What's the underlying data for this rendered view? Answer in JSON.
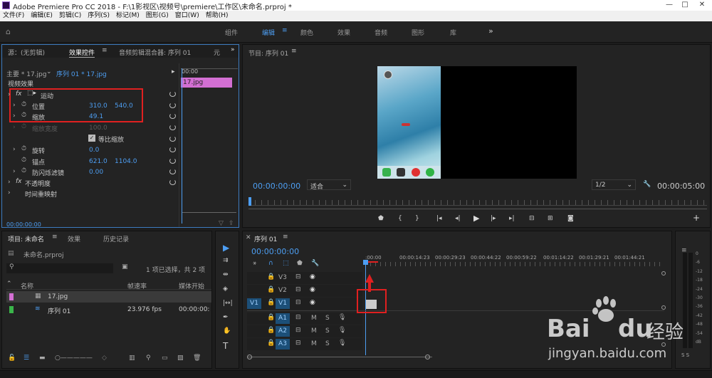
{
  "window": {
    "title": "Adobe Premiere Pro CC 2018 - F:\\1影视区\\视频号\\premiere\\工作区\\未命名.prproj *",
    "controls": [
      "—",
      "□",
      "✕"
    ]
  },
  "menu": [
    "文件(F)",
    "编辑(E)",
    "剪辑(C)",
    "序列(S)",
    "标记(M)",
    "图形(G)",
    "窗口(W)",
    "帮助(H)"
  ],
  "workspaces": [
    "组件",
    "编辑",
    "颜色",
    "效果",
    "音频",
    "图形",
    "库"
  ],
  "workspace_more": "»",
  "effect_controls": {
    "tabs": [
      "源：(无剪辑)",
      "效果控件",
      "音频剪辑混合器: 序列 01",
      "元"
    ],
    "master_label": "主要 * 17.jpg",
    "seq_label": "序列 01 * 17.jpg",
    "timecode_start": "00:00",
    "clip_name": "17.jpg",
    "video_effects": "视频效果",
    "motion": "运动",
    "position": {
      "label": "位置",
      "x": "310.0",
      "y": "540.0"
    },
    "scale": {
      "label": "缩放",
      "value": "49.1"
    },
    "scale_width": {
      "label": "缩放宽度",
      "value": "100.0"
    },
    "uniform_scale": "等比缩放",
    "rotation": {
      "label": "旋转",
      "value": "0.0"
    },
    "anchor": {
      "label": "锚点",
      "x": "621.0",
      "y": "1104.0"
    },
    "anti_flicker": {
      "label": "防闪烁滤镜",
      "value": "0.00"
    },
    "opacity": "不透明度",
    "time_remap": "时间重映射",
    "footer_time": "00:00:00:00"
  },
  "program": {
    "title": "节目: 序列 01",
    "timecode": "00:00:00:00",
    "fit": "适合",
    "resolution": "1/2",
    "duration": "00:00:05:00"
  },
  "project": {
    "tabs": [
      "项目: 未命名",
      "效果",
      "历史记录"
    ],
    "file": "未命名.prproj",
    "selection": "1 项已选择，共 2 项",
    "columns": [
      "名称",
      "帧速率",
      "媒体开始"
    ],
    "items": [
      {
        "name": "17.jpg",
        "fps": "",
        "start": "",
        "color": "#d36fd3"
      },
      {
        "name": "序列 01",
        "fps": "23.976 fps",
        "start": "00:00:00:",
        "color": "#3ab54a"
      }
    ]
  },
  "timeline": {
    "title": "序列 01",
    "timecode": "00:00:00:00",
    "ruler": [
      ":00:00",
      "00:00:14:23",
      "00:00:29:23",
      "00:00:44:22",
      "00:00:59:22",
      "00:01:14:22",
      "00:01:29:21",
      "00:01:44:21"
    ],
    "video_tracks": [
      "V3",
      "V2",
      "V1"
    ],
    "audio_tracks": [
      "A1",
      "A2",
      "A3"
    ],
    "source_patch": "V1",
    "mute": "M",
    "solo": "S"
  },
  "audio_meter": {
    "labels": [
      "0",
      "-6",
      "-12",
      "-18",
      "-24",
      "-30",
      "-36",
      "-42",
      "-48",
      "-54",
      "dB"
    ],
    "bottom": "S S"
  },
  "watermark": {
    "brand": "Bai",
    "brand2": "du",
    "suffix": "经验",
    "url": "jingyan.baidu.com"
  },
  "colors": {
    "accent": "#4d9ef2",
    "clip": "#d36fd3",
    "highlight": "#e02020"
  }
}
